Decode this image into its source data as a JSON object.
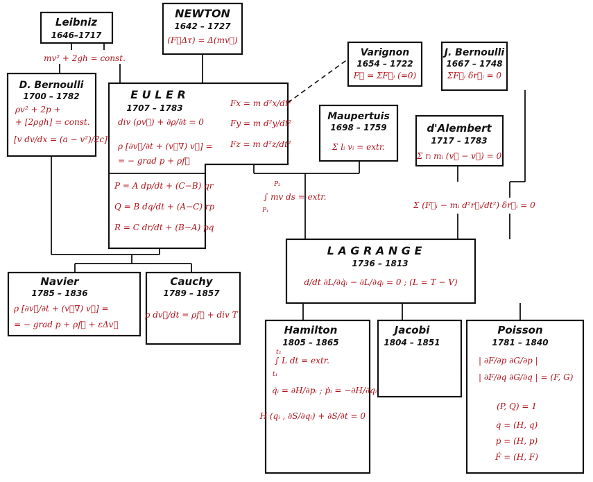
{
  "colors": {
    "ink": "#111111",
    "formula": "#b0141c",
    "paper": "#ffffff"
  },
  "leibniz": {
    "name": "Leibniz",
    "years": "1646–1717",
    "eq": "mv² + 2gh = const."
  },
  "newton": {
    "name": "NEWTON",
    "years": "1642 – 1727",
    "eq": "(F⃗Δτ) = Δ(mv⃗)"
  },
  "varignon": {
    "name": "Varignon",
    "years": "1654 – 1722",
    "eq": "F⃗ = ΣF⃗ᵢ (=0)"
  },
  "jbernoulli": {
    "name": "J. Bernoulli",
    "years": "1667 – 1748",
    "eq": "ΣF⃗ᵢ δr⃗ᵢ = 0"
  },
  "dbernoulli": {
    "name": "D. Bernoulli",
    "years": "1700 – 1782",
    "eq1": "ρv² + 2p +",
    "eq2": "+ [2ρgh] = const.",
    "eq3": "[v dv/dx = (a − v²)/2c]"
  },
  "euler": {
    "name": "E U L E R",
    "years": "1707 – 1783",
    "eq1": "div (ρv⃗) + ∂ρ/∂t = 0",
    "eq2": "ρ [∂v⃗/∂t + (v⃗∇) v⃗] =",
    "eq3": "= − grad p + ρf⃗",
    "fx": "Fx = m d²x/dt²",
    "fy": "Fy = m d²y/dt²",
    "fz": "Fz = m d²z/dt²",
    "p": "P = A dp/dt + (C−B) qr",
    "q": "Q = B dq/dt + (A−C) rp",
    "r": "R = C dr/dt + (B−A) pq"
  },
  "maupertuis": {
    "name": "Maupertuis",
    "years": "1698 – 1759",
    "eq": "Σ lᵢ vᵢ = extr."
  },
  "dalembert": {
    "name": "d'Alembert",
    "years": "1717 – 1783",
    "eq": "Σ rᵢ mᵢ (v⃗ − v⃗) = 0"
  },
  "link_least_action": "∫ mv ds = extr.",
  "link_least_action_lower": "P₁",
  "link_least_action_upper": "P₂",
  "link_virtual_work": "Σ (F⃗ᵢ − mᵢ d²r⃗ᵢ/dt²) δr⃗ᵢ = 0",
  "lagrange": {
    "name": "L A G R A N G E",
    "years": "1736 – 1813",
    "eq": "d/dt ∂L/∂q̇ᵢ − ∂L/∂qᵢ = 0 ;   (L = T − V)"
  },
  "navier": {
    "name": "Navier",
    "years": "1785 – 1836",
    "eq1": "ρ [∂v⃗/∂t + (v⃗∇) v⃗] =",
    "eq2": "= − grad p + ρf⃗ + εΔv⃗"
  },
  "cauchy": {
    "name": "Cauchy",
    "years": "1789 – 1857",
    "eq": "ρ dv⃗/dt = ρf⃗ + div T"
  },
  "hamilton": {
    "name": "Hamilton",
    "years": "1805 – 1865",
    "eq1": "∫ L dt = extr.",
    "eq1_lower": "t₁",
    "eq1_upper": "t₂",
    "eq2": "q̇ᵢ = ∂H/∂pᵢ ;  ṗᵢ = −∂H/∂qᵢ",
    "eq3": "H (qᵢ , ∂S/∂qᵢ) + ∂S/∂t = 0"
  },
  "jacobi": {
    "name": "Jacobi",
    "years": "1804 – 1851"
  },
  "poisson": {
    "name": "Poisson",
    "years": "1781 – 1840",
    "eq1": "| ∂F/∂p  ∂G/∂p |",
    "eq2": "| ∂F/∂q  ∂G/∂q |  = (F, G)",
    "eq3": "(P, Q) = 1",
    "eq4": "q̇ = (H, q)",
    "eq5": "ṗ = (H, p)",
    "eq6": "Ḟ = (H, F)"
  }
}
